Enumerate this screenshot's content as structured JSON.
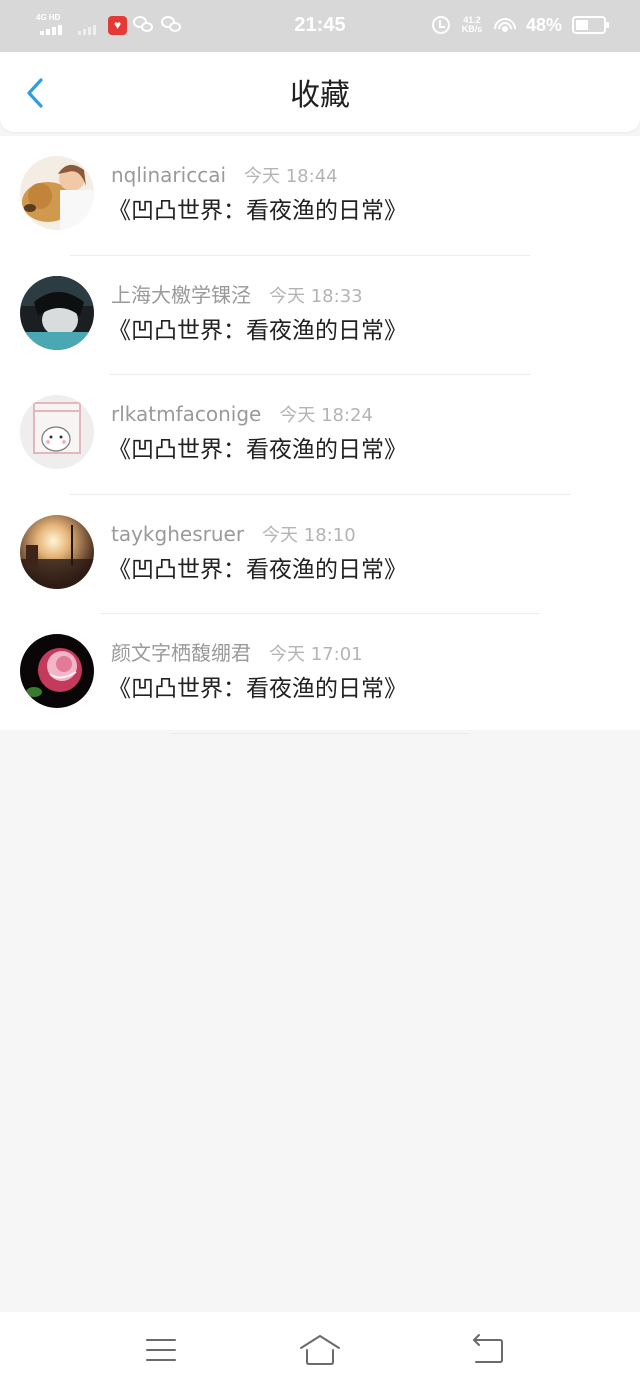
{
  "status_bar": {
    "network": "4G HD",
    "time": "21:45",
    "net_speed": "41.2 KB/s",
    "battery": "48%",
    "battery_level": 0.48,
    "icons": [
      "signal-icon",
      "app-notification-icon",
      "wechat-icon",
      "wechat-icon",
      "alarm-icon",
      "wifi-icon",
      "battery-icon"
    ]
  },
  "header": {
    "title": "收藏",
    "back_icon": "chevron-left-icon",
    "accent_color": "#2d9ee0"
  },
  "favorites": [
    {
      "username": "nqlinariccai",
      "time": "今天 18:44",
      "title": "《凹凸世界：看夜渔的日常》"
    },
    {
      "username": "上海大檄学锞泾",
      "time": "今天 18:33",
      "title": "《凹凸世界：看夜渔的日常》"
    },
    {
      "username": "rlkatmfaconige",
      "time": "今天 18:24",
      "title": "《凹凸世界：看夜渔的日常》"
    },
    {
      "username": "taykghesruer",
      "time": "今天 18:10",
      "title": "《凹凸世界：看夜渔的日常》"
    },
    {
      "username": "颜文字栖馥绷君",
      "time": "今天 17:01",
      "title": "《凹凸世界：看夜渔的日常》"
    }
  ],
  "nav_bar": {
    "icons": [
      "menu-icon",
      "home-icon",
      "back-icon"
    ]
  }
}
